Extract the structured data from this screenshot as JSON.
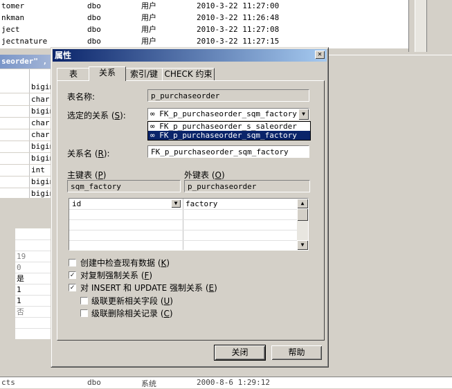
{
  "background": {
    "top_rows": [
      {
        "name": "tomer",
        "owner": "dbo",
        "type": "用户",
        "created": "2010-3-22 11:27:00"
      },
      {
        "name": "nkman",
        "owner": "dbo",
        "type": "用户",
        "created": "2010-3-22 11:26:48"
      },
      {
        "name": "ject",
        "owner": "dbo",
        "type": "用户",
        "created": "2010-3-22 11:27:08"
      },
      {
        "name": "jectnature",
        "owner": "dbo",
        "type": "用户",
        "created": "2010-3-22 11:27:15"
      }
    ],
    "caption": "seorder\" ,",
    "grid_types": [
      "bigin",
      "char",
      "bigin",
      "char",
      "char",
      "bigin",
      "bigin",
      "int",
      "bigin",
      "bigin"
    ],
    "props": [
      "19",
      "0",
      "是",
      "1",
      "1",
      "否"
    ],
    "bottom_row": {
      "name": "cts",
      "owner": "dbo",
      "type": "系统",
      "created": "2000-8-6 1:29:12"
    }
  },
  "dialog": {
    "title": "属性",
    "close_glyph": "✕",
    "tabs": [
      "表",
      "关系",
      "索引/键",
      "CHECK 约束"
    ],
    "active_tab": "关系",
    "table_name_label": "表名称:",
    "table_name": "p_purchaseorder",
    "selected_relation_label_pre": "选定的关系 (",
    "selected_relation_label_key": "S",
    "selected_relation_label_post": "):",
    "selected_relation": "FK_p_purchaseorder_sqm_factory",
    "dropdown_options": [
      "FK_p_purchaseorder_s_saleorder",
      "FK_p_purchaseorder_sqm_factory"
    ],
    "relation_name_label_pre": "关系名 (",
    "relation_name_label_key": "R",
    "relation_name_label_post": "):",
    "relation_name": "FK_p_purchaseorder_sqm_factory",
    "pk_table_label_pre": "主键表 (",
    "pk_table_label_key": "P",
    "pk_table_label_post": ")",
    "pk_table": "sqm_factory",
    "fk_table_label_pre": "外键表 (",
    "fk_table_label_key": "O",
    "fk_table_label_post": ")",
    "fk_table": "p_purchaseorder",
    "mapping": [
      {
        "pk": "id",
        "fk": "factory"
      }
    ],
    "options": [
      {
        "pre": "创建中检查现有数据 (",
        "key": "K",
        "post": ")",
        "checked": false
      },
      {
        "pre": "对复制强制关系 (",
        "key": "F",
        "post": ")",
        "checked": true
      },
      {
        "pre": "对 INSERT 和 UPDATE 强制关系 (",
        "key": "E",
        "post": ")",
        "checked": true
      },
      {
        "pre": "级联更新相关字段 (",
        "key": "U",
        "post": ")",
        "checked": false
      },
      {
        "pre": "级联删除相关记录 (",
        "key": "C",
        "post": ")",
        "checked": false
      }
    ],
    "check_glyph": "✓",
    "close_button": "关闭",
    "help_button": "帮助"
  }
}
